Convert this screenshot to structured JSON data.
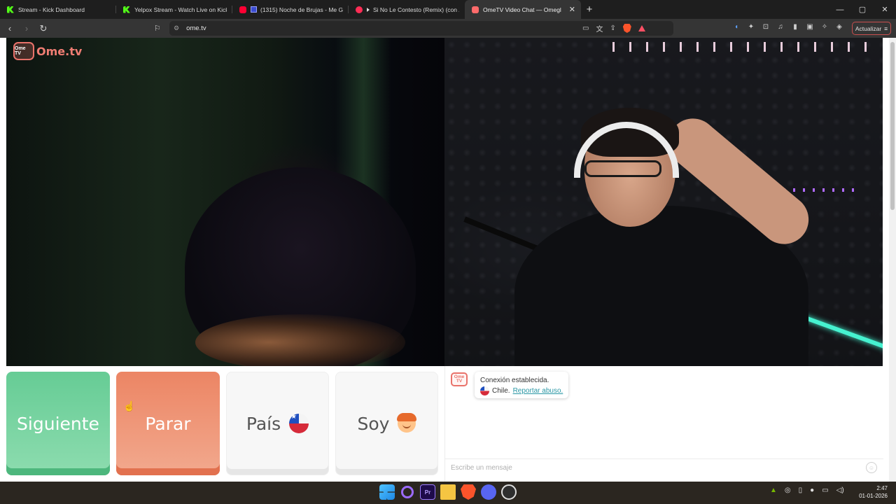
{
  "browser": {
    "tabs": [
      {
        "label": "Stream - Kick Dashboard",
        "icon": "kick-icon",
        "active": false
      },
      {
        "label": "Yelpox Stream - Watch Live on Kick",
        "icon": "kick-icon",
        "active": false
      },
      {
        "label": "(1315) Noche de Brujas - Me Gus",
        "icon": "youtube-icon",
        "active": false
      },
      {
        "label": "Si No Le Contesto (Remix) (con Z",
        "icon": "record-icon",
        "active": false
      },
      {
        "label": "OmeTV Video Chat — Omegl",
        "icon": "ometv-icon",
        "active": true
      }
    ],
    "new_tab": "+",
    "window_controls": {
      "minimize": "—",
      "maximize": "▢",
      "close": "✕"
    },
    "url": "ome.tv",
    "update_button": "Actualizar"
  },
  "site": {
    "logo_text": "Ome.tv",
    "logo_badge": "Ome TV"
  },
  "controls": {
    "next": "Siguiente",
    "stop": "Parar",
    "country": "País",
    "iam": "Soy"
  },
  "chat": {
    "avatar_text": "Ome TV",
    "status": "Conexión establecida.",
    "country": "Chile.",
    "report_link": "Reportar abuso.",
    "input_placeholder": "Escribe un mensaje"
  },
  "taskbar": {
    "apps": [
      "windows-start-icon",
      "circle-app-icon",
      "premiere-icon",
      "file-explorer-icon",
      "brave-icon",
      "discord-icon",
      "obs-icon"
    ],
    "premiere_label": "Pr",
    "time": "2:47",
    "date": "01-01-2026"
  },
  "colors": {
    "next_button": "#66cc95",
    "stop_button": "#ec8564",
    "brand": "#e9726a",
    "link": "#2a97a5"
  }
}
